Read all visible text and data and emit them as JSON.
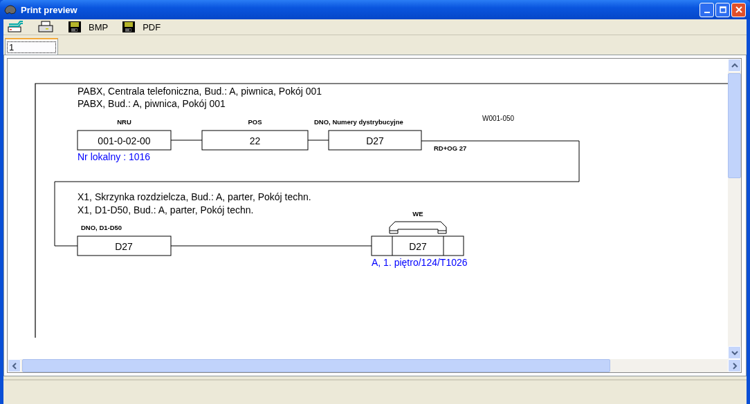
{
  "window": {
    "title": "Print preview"
  },
  "toolbar": [
    {
      "kind": "printer-setup"
    },
    {
      "kind": "print"
    },
    {
      "kind": "save",
      "label": "BMP"
    },
    {
      "kind": "save",
      "label": "PDF"
    }
  ],
  "tabs": [
    {
      "label": "1",
      "selected": true
    }
  ],
  "diagram": {
    "source": {
      "lines": [
        "PABX, Centrala telefoniczna, Bud.: A, piwnica, Pokój 001",
        "PABX, Bud.: A, piwnica, Pokój 001"
      ],
      "nodes": [
        {
          "caption": "NRU",
          "value": "001-0-02-00",
          "note": "Nr lokalny : 1016"
        },
        {
          "caption": "POS",
          "value": "22"
        },
        {
          "caption": "DNO, Numery dystrybucyjne",
          "value": "D27"
        }
      ],
      "cable": "W001-050",
      "wire": "RD+OG  27"
    },
    "target": {
      "lines": [
        "X1, Skrzynka rozdzielcza, Bud.: A, parter, Pokój techn.",
        "X1, D1-D50, Bud.: A, parter, Pokój techn."
      ],
      "nodes": [
        {
          "caption": "DNO, D1-D50",
          "value": "D27"
        }
      ],
      "outlet": {
        "caption": "WE",
        "value": "D27",
        "note": "A, 1. piętro/124/T1026"
      }
    }
  }
}
